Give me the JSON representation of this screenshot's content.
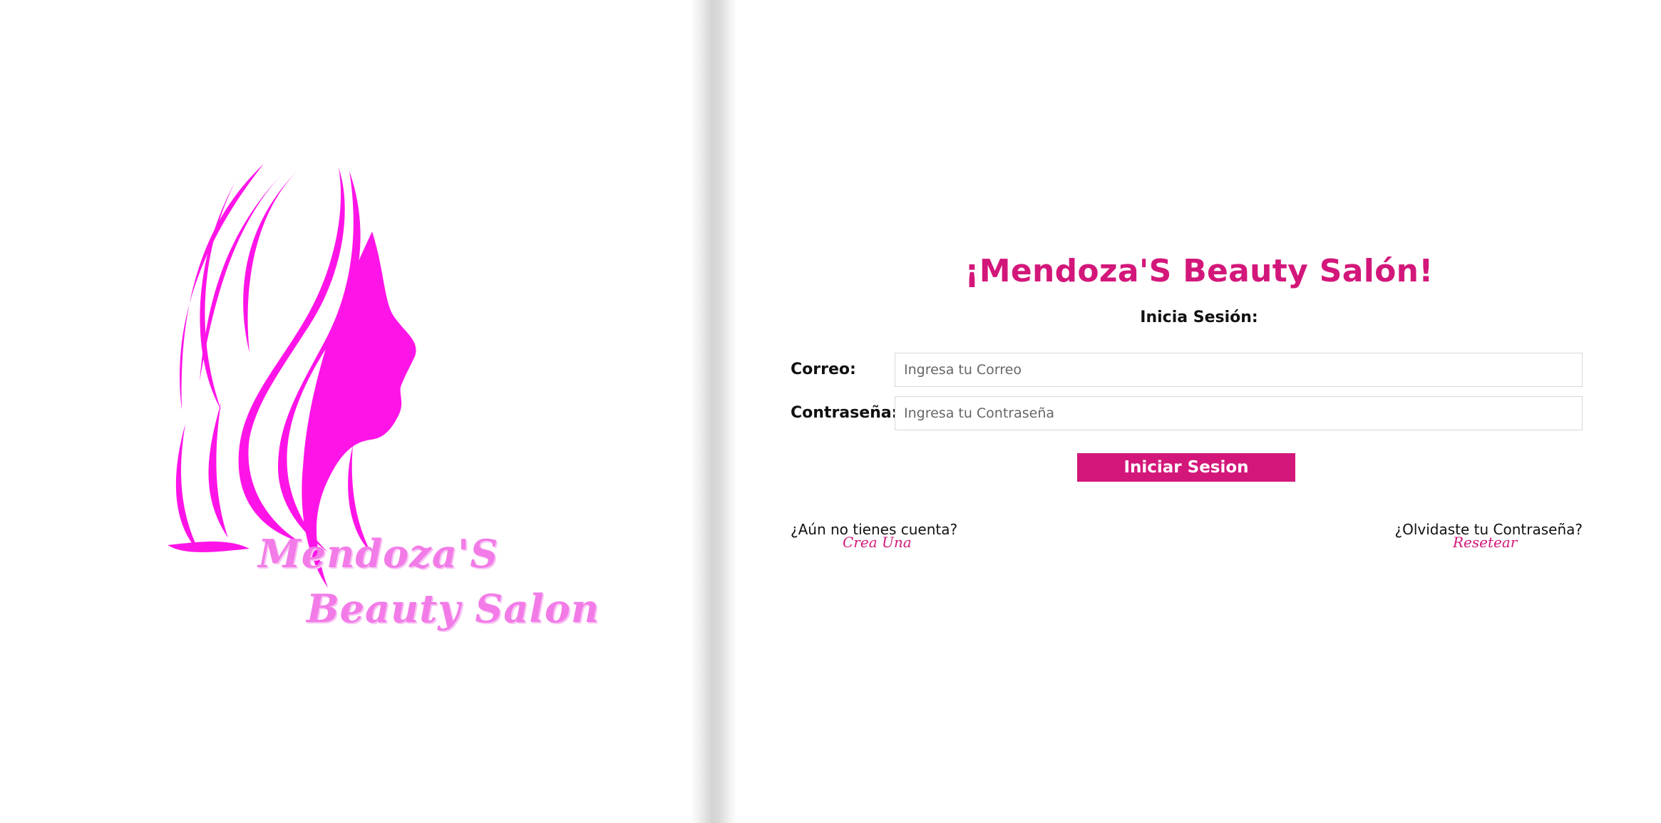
{
  "brand": {
    "logo_line1": "Mendoza'S",
    "logo_line2": "Beauty Salon",
    "colors": {
      "logo_magenta": "#ff14e8",
      "logo_text_pink": "#f27be8",
      "accent": "#d3177a"
    }
  },
  "login": {
    "title": "¡Mendoza'S Beauty Salón!",
    "subtitle": "Inicia Sesión:",
    "email_label": "Correo:",
    "email_placeholder": "Ingresa tu Correo",
    "email_value": "",
    "password_label": "Contraseña:",
    "password_placeholder": "Ingresa tu Contraseña",
    "password_value": "",
    "submit_label": "Iniciar Sesion",
    "no_account_text": "¿Aún no tienes cuenta?",
    "create_link": "Crea Una",
    "forgot_text": "¿Olvidaste tu Contraseña?",
    "reset_link": "Resetear"
  },
  "icons": {
    "logo": "woman-profile-silhouette-icon"
  }
}
